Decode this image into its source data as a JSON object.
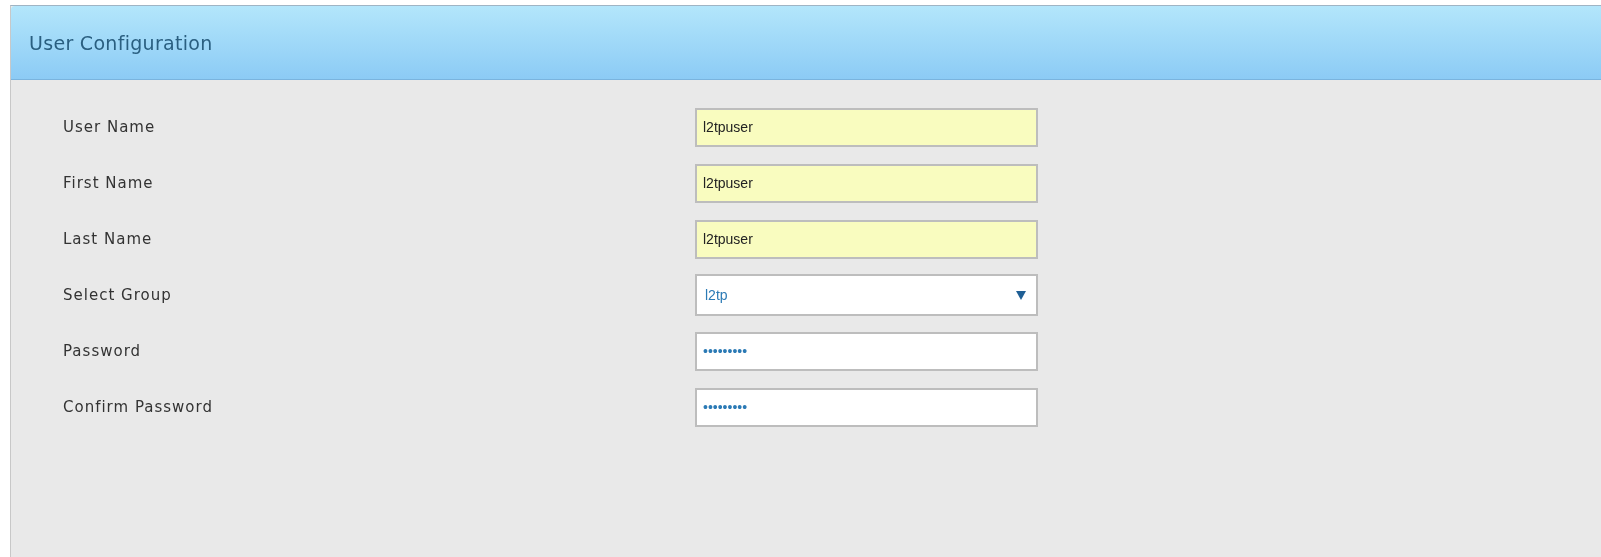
{
  "panel": {
    "title": "User Configuration"
  },
  "fields": [
    {
      "label": "User Name",
      "kind": "text",
      "value": "l2tpuser"
    },
    {
      "label": "First Name",
      "kind": "text",
      "value": "l2tpuser"
    },
    {
      "label": "Last Name",
      "kind": "text",
      "value": "l2tpuser"
    },
    {
      "label": "Select Group",
      "kind": "select",
      "value": "l2tp"
    },
    {
      "label": "Password",
      "kind": "password",
      "value": "•••••••••"
    },
    {
      "label": "Confirm Password",
      "kind": "password",
      "value": "•••••••••"
    }
  ]
}
